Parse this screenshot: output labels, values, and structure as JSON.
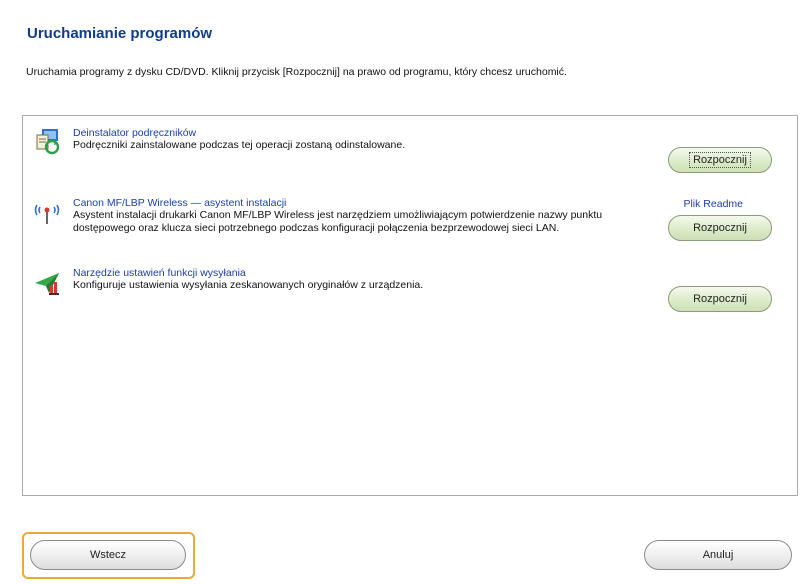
{
  "header": {
    "title": "Uruchamianie programów",
    "instruction": "Uruchamia programy z dysku CD/DVD. Kliknij przycisk [Rozpocznij] na prawo od programu, który chcesz uruchomić."
  },
  "programs": [
    {
      "name": "Deinstalator podręczników",
      "description": "Podręczniki zainstalowane podczas tej operacji zostaną odinstalowane.",
      "icon": "uninstaller-icon",
      "button_label": "Rozpocznij"
    },
    {
      "name": "Canon MF/LBP Wireless — asystent instalacji",
      "description": "Asystent instalacji drukarki Canon MF/LBP Wireless jest narzędziem umożliwiającym potwierdzenie nazwy punktu dostępowego oraz klucza sieci potrzebnego podczas konfiguracji połączenia bezprzewodowej sieci LAN.",
      "icon": "wireless-icon",
      "readme_label": "Plik Readme",
      "button_label": "Rozpocznij"
    },
    {
      "name": "Narzędzie ustawień funkcji wysyłania",
      "description": "Konfiguruje ustawienia wysyłania zeskanowanych oryginałów z urządzenia.",
      "icon": "send-settings-icon",
      "button_label": "Rozpocznij"
    }
  ],
  "footer": {
    "back_label": "Wstecz",
    "cancel_label": "Anuluj"
  },
  "colors": {
    "title": "#0f3c8f",
    "link": "#1c3ea8",
    "start_button": "#dcebc9",
    "highlight": "#f0a63a"
  }
}
